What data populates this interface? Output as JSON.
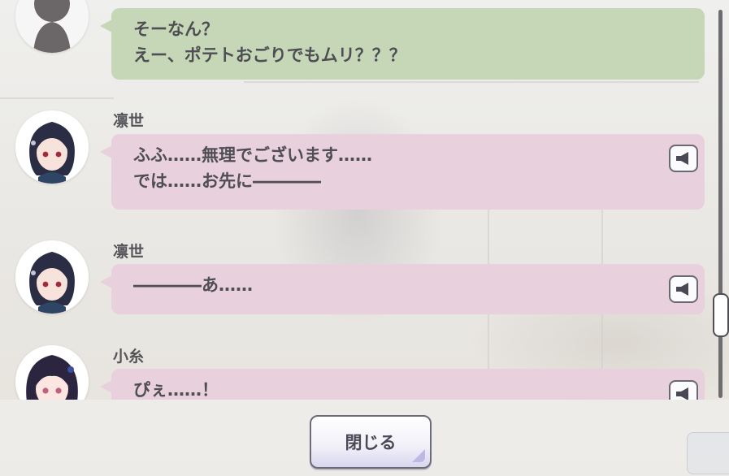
{
  "colors": {
    "green_bubble": "#c5d7b6",
    "pink_bubble": "#e8d0dc",
    "text": "#4f4e54",
    "scrollbar": "#6d6d6f"
  },
  "log": {
    "entries": [
      {
        "speaker": "",
        "bubble_color": "green",
        "lines": [
          "そーなん？",
          "えー、ポテトおごりでもムリ？？？"
        ],
        "has_voice": false
      },
      {
        "speaker": "凛世",
        "bubble_color": "pink",
        "lines": [
          "ふふ……無理でございます……",
          "では……お先に――――"
        ],
        "has_voice": true
      },
      {
        "speaker": "凛世",
        "bubble_color": "pink",
        "lines": [
          "――――あ……"
        ],
        "has_voice": true
      },
      {
        "speaker": "小糸",
        "bubble_color": "pink",
        "lines": [
          "ぴぇ……！"
        ],
        "has_voice": true
      }
    ]
  },
  "icons": {
    "voice": "speaker-icon"
  },
  "scroll": {
    "position": 0.75
  },
  "footer": {
    "close_label": "閉じる"
  }
}
